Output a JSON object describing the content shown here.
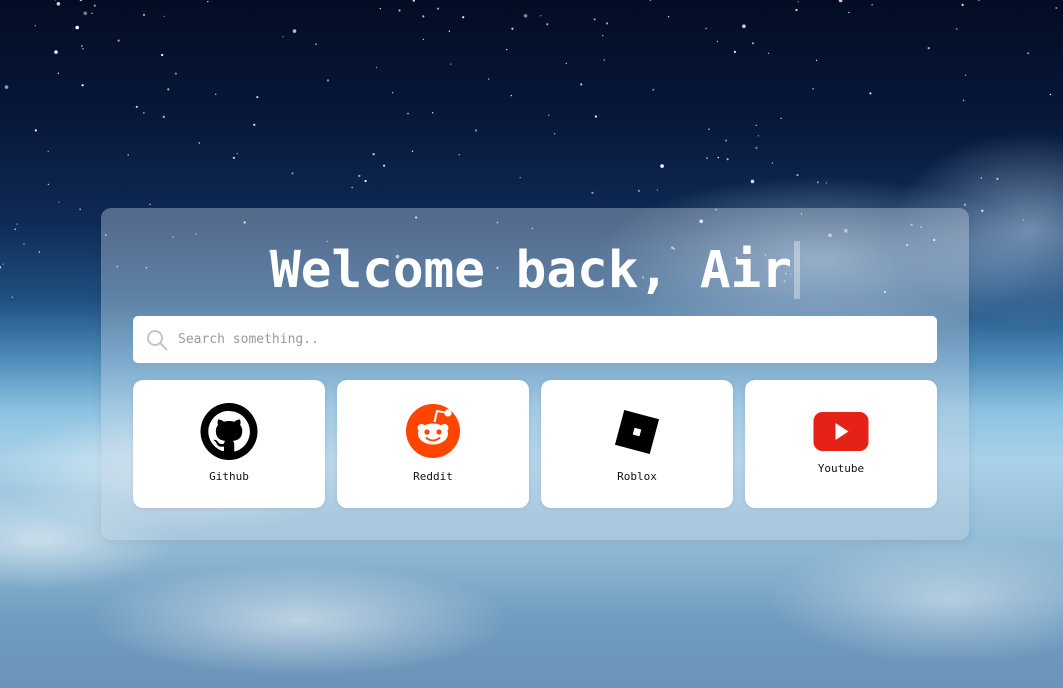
{
  "header": {
    "greeting": "Welcome back, Air"
  },
  "search": {
    "placeholder": "Search something..",
    "value": "",
    "icon": "search-icon"
  },
  "shortcuts": [
    {
      "label": "Github",
      "icon": "github-icon",
      "color": "#000000"
    },
    {
      "label": "Reddit",
      "icon": "reddit-icon",
      "color": "#ff4500"
    },
    {
      "label": "Roblox",
      "icon": "roblox-icon",
      "color": "#000000"
    },
    {
      "label": "Youtube",
      "icon": "youtube-icon",
      "color": "#e62117"
    }
  ]
}
